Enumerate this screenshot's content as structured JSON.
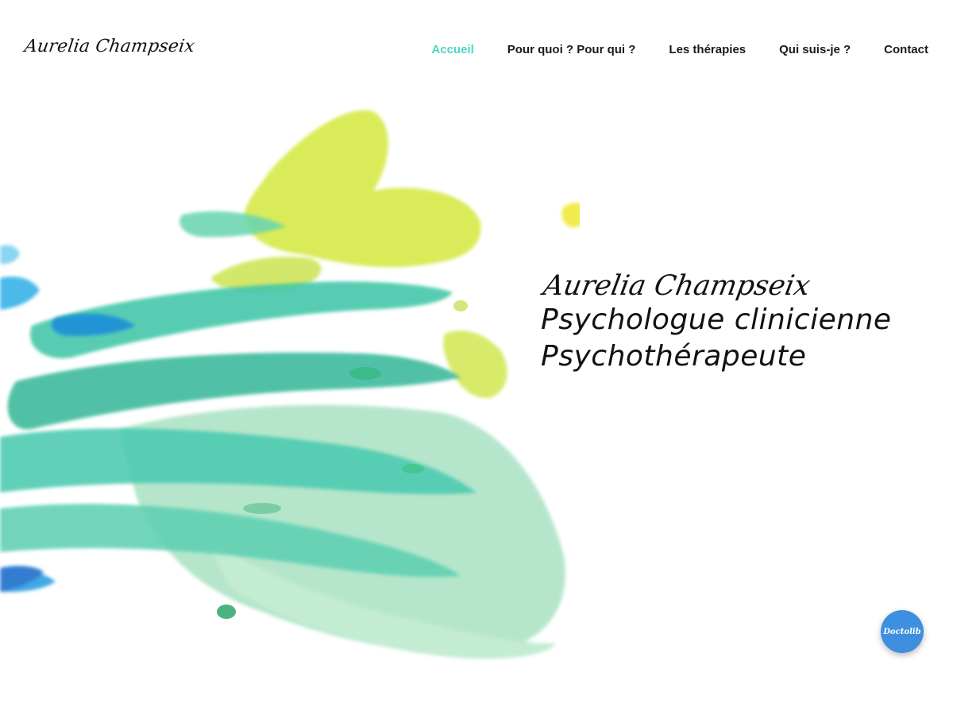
{
  "header": {
    "logo_text": "Aurelia Champseix",
    "nav": [
      {
        "label": "Accueil",
        "active": true
      },
      {
        "label": "Pour quoi ? Pour qui ?",
        "active": false
      },
      {
        "label": "Les thérapies",
        "active": false
      },
      {
        "label": "Qui suis-je ?",
        "active": false
      },
      {
        "label": "Contact",
        "active": false
      }
    ]
  },
  "hero": {
    "name": "Aurelia Champseix",
    "line1": "Psychologue clinicienne",
    "line2": "Psychothérapeute",
    "art_icon": "watercolor-splash-icon"
  },
  "doctolib": {
    "label": "Doctolib",
    "icon": "doctolib-icon"
  },
  "colors": {
    "accent": "#48d6c4",
    "text": "#111111",
    "doctolib_blue": "#3f8fe0",
    "paint_yellow": "#d7e94a",
    "paint_teal": "#3fc6a8",
    "paint_blue": "#1f8fd9",
    "paint_mint": "#a9e2c2"
  }
}
